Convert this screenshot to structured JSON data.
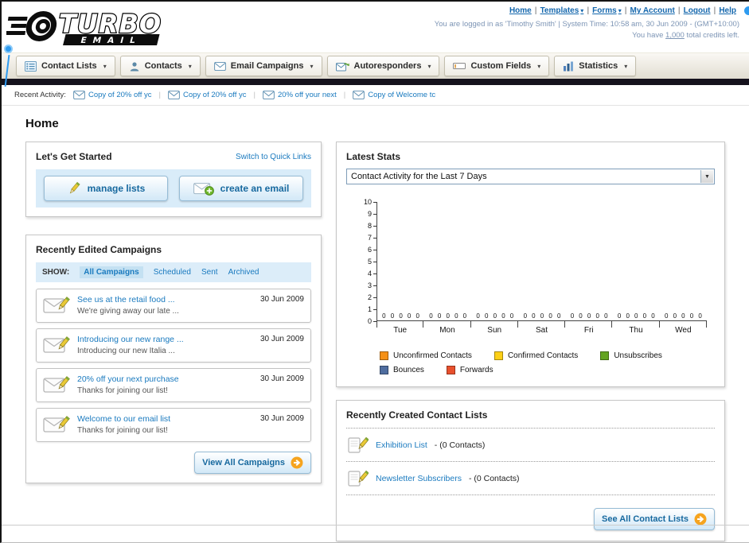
{
  "colors": {
    "link_blue": "#1a7abf",
    "accent_orange": "#f6a41f",
    "dark_bar": "#15121d",
    "panel_blue": "#d9ecf9"
  },
  "header": {
    "logo_line1": "TURBO",
    "logo_line2": "EMAIL",
    "nav_links": [
      {
        "label": "Home",
        "dropdown": false
      },
      {
        "label": "Templates",
        "dropdown": true
      },
      {
        "label": "Forms",
        "dropdown": true
      },
      {
        "label": "My Account",
        "dropdown": false
      },
      {
        "label": "Logout",
        "dropdown": false
      },
      {
        "label": "Help",
        "dropdown": false
      }
    ],
    "login_info": "You are logged in as 'Timothy Smith' | System Time: 10:58 am, 30 Jun 2009 - (GMT+10:00)",
    "credits_prefix": "You have ",
    "credits_link": "1,000",
    "credits_suffix": " total credits left."
  },
  "nav_tabs": [
    {
      "label": "Contact Lists",
      "icon": "list"
    },
    {
      "label": "Contacts",
      "icon": "person"
    },
    {
      "label": "Email Campaigns",
      "icon": "envelope"
    },
    {
      "label": "Autoresponders",
      "icon": "autoresponder"
    },
    {
      "label": "Custom Fields",
      "icon": "field"
    },
    {
      "label": "Statistics",
      "icon": "stats"
    }
  ],
  "recent_activity": {
    "label": "Recent Activity:",
    "items": [
      "Copy of 20% off yc",
      "Copy of 20% off yc",
      "20% off your next",
      "Copy of Welcome tc"
    ]
  },
  "page_title": "Home",
  "get_started": {
    "title": "Let's Get Started",
    "switch_link": "Switch to Quick Links",
    "manage_lists_label": "manage lists",
    "create_email_label": "create an email"
  },
  "campaigns": {
    "title": "Recently Edited Campaigns",
    "show_label": "SHOW:",
    "filters": [
      "All Campaigns",
      "Scheduled",
      "Sent",
      "Archived"
    ],
    "active_filter": "All Campaigns",
    "items": [
      {
        "title": "See us at the retail food ...",
        "subtitle": "We're giving away our late ...",
        "date": "30 Jun 2009"
      },
      {
        "title": "Introducing our new range ...",
        "subtitle": "Introducing our new Italia ...",
        "date": "30 Jun 2009"
      },
      {
        "title": "20% off your next purchase",
        "subtitle": "Thanks for joining our list!",
        "date": "30 Jun 2009"
      },
      {
        "title": "Welcome to our email list",
        "subtitle": "Thanks for joining our list!",
        "date": "30 Jun 2009"
      }
    ],
    "view_all_label": "View All Campaigns"
  },
  "stats": {
    "title": "Latest Stats",
    "activity_select_value": "Contact Activity for the Last 7 Days",
    "legend_rows": [
      [
        {
          "label": "Unconfirmed Contacts",
          "color": "#f59016"
        },
        {
          "label": "Confirmed Contacts",
          "color": "#fdd017"
        },
        {
          "label": "Unsubscribes",
          "color": "#64a422"
        }
      ],
      [
        {
          "label": "Bounces",
          "color": "#4f6d9f"
        },
        {
          "label": "Forwards",
          "color": "#e8502d"
        }
      ]
    ]
  },
  "chart_data": {
    "type": "bar",
    "title": "Contact Activity for the Last 7 Days",
    "categories": [
      "Tue",
      "Mon",
      "Sun",
      "Sat",
      "Fri",
      "Thu",
      "Wed"
    ],
    "series": [
      {
        "name": "Unconfirmed Contacts",
        "color": "#f59016",
        "values": [
          0,
          0,
          0,
          0,
          0,
          0,
          0
        ]
      },
      {
        "name": "Confirmed Contacts",
        "color": "#fdd017",
        "values": [
          0,
          0,
          0,
          0,
          0,
          0,
          0
        ]
      },
      {
        "name": "Unsubscribes",
        "color": "#64a422",
        "values": [
          0,
          0,
          0,
          0,
          0,
          0,
          0
        ]
      },
      {
        "name": "Bounces",
        "color": "#4f6d9f",
        "values": [
          0,
          0,
          0,
          0,
          0,
          0,
          0
        ]
      },
      {
        "name": "Forwards",
        "color": "#e8502d",
        "values": [
          0,
          0,
          0,
          0,
          0,
          0,
          0
        ]
      }
    ],
    "ylim": [
      0,
      10
    ],
    "ytick_step": 1,
    "show_value_labels": true,
    "legend_position": "bottom",
    "grid": false
  },
  "contact_lists": {
    "title": "Recently Created Contact Lists",
    "items": [
      {
        "name": "Exhibition List",
        "detail": "- (0 Contacts)"
      },
      {
        "name": "Newsletter Subscribers",
        "detail": "- (0 Contacts)"
      }
    ],
    "see_all_label": "See All Contact Lists"
  }
}
